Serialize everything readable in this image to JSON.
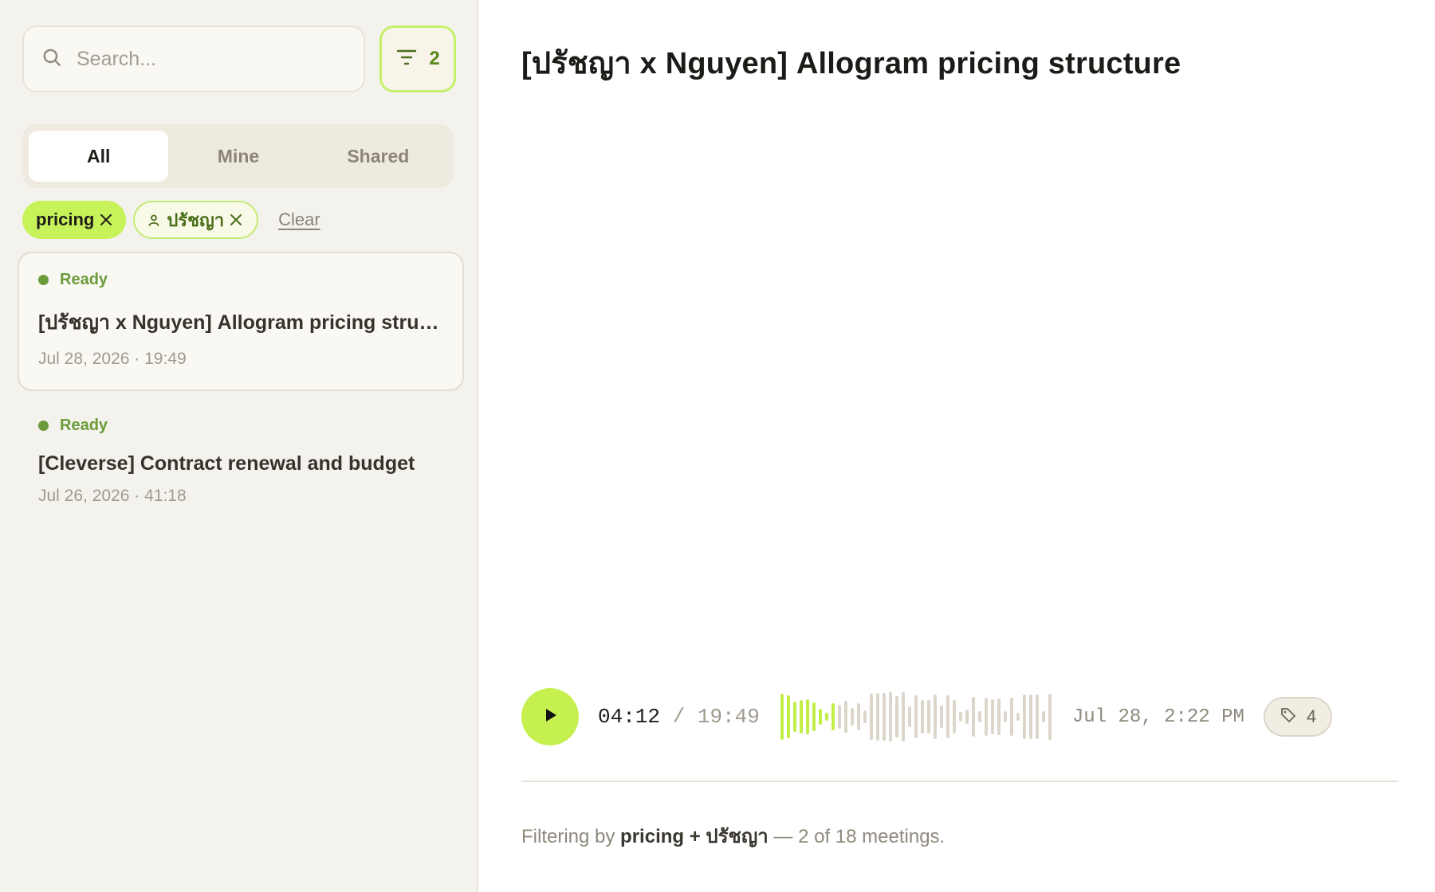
{
  "sidebar": {
    "search": {
      "placeholder": "Search...",
      "value": ""
    },
    "filter_button": {
      "count": "2"
    },
    "tabs": [
      {
        "label": "All",
        "active": true
      },
      {
        "label": "Mine",
        "active": false
      },
      {
        "label": "Shared",
        "active": false
      }
    ],
    "chips": {
      "tag": "pricing",
      "person": "ปรัชญา",
      "clear_label": "Clear"
    },
    "meetings": [
      {
        "status": "Ready",
        "title": "[ปรัชญา x Nguyen] Allogram pricing structure",
        "meta": "Jul 28, 2026 · 19:49",
        "selected": true
      },
      {
        "status": "Ready",
        "title": "[Cleverse] Contract renewal and budget",
        "meta": "Jul 26, 2026 · 41:18",
        "selected": false
      }
    ]
  },
  "main": {
    "title": "[ปรัชญา x Nguyen] Allogram pricing structure",
    "player": {
      "current_time": "04:12",
      "separator": "/",
      "duration": "19:49",
      "played_fraction": 0.21,
      "recorded_at": "Jul 28, 2:22 PM",
      "tag_count": "4"
    },
    "footer": {
      "prefix": "Filtering by",
      "filters": "pricing + ปรัชญา",
      "suffix": "— 2 of 18 meetings."
    }
  },
  "colors": {
    "accent": "#c5f04f",
    "status_ready": "#6b9b3a",
    "sidebar_bg": "#f4f2ec"
  },
  "icons": [
    "search-icon",
    "filter-icon",
    "close-icon",
    "person-icon",
    "play-icon",
    "tag-icon"
  ]
}
